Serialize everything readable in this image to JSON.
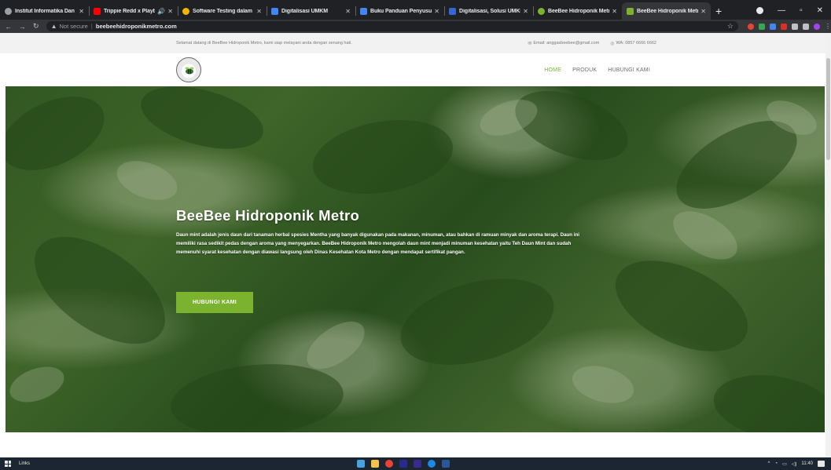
{
  "browser": {
    "tabs": [
      {
        "title": "Institut Informatika Dan Bi",
        "color": "#9aa0a6"
      },
      {
        "title": "Trippie Redd x Playbo",
        "color": "#ff0000"
      },
      {
        "title": "Software Testing dalam In",
        "color": "#f4b400"
      },
      {
        "title": "Digitalisasi UMKM",
        "color": "#4285f4"
      },
      {
        "title": "Buku Panduan Penyusuna",
        "color": "#4285f4"
      },
      {
        "title": "Digitalisasi, Solusi UMKM",
        "color": "#3367d6"
      },
      {
        "title": "BeeBee Hidroponik Metro",
        "color": "#7bb32e"
      },
      {
        "title": "BeeBee Hidroponik Metro",
        "color": "#7bb32e"
      }
    ],
    "not_secure": "Not secure",
    "url": "beebeehidroponikmetro.com"
  },
  "site": {
    "welcome": "Selamat datang di BeeBee Hidroponik Metro, kami siap melayani anda dengan senang hati.",
    "email": "Email: anggasbeebee@gmail.com",
    "wa": "WA: 0857 6666 6662",
    "nav": {
      "home": "HOME",
      "produk": "PRODUK",
      "hubungi": "HUBUNGI KAMI"
    },
    "hero": {
      "title": "BeeBee Hidroponik Metro",
      "text": "Daun mint adalah jenis daun dari tanaman herbal spesies Mentha yang banyak digunakan pada makanan, minuman, atau bahkan di ramuan minyak dan aroma terapi. Daun ini memiliki rasa sedikit pedas dengan aroma yang menyegarkan. BeeBee Hidroponik Metro mengolah daun mint menjadi minuman kesehatan yaitu Teh Daun Mint dan sudah memenuhi syarat kesehatan dengan diawasi langsung oleh Dinas Kesehatan Kota Metro dengan mendapat sertifikat pangan.",
      "button": "HUBUNGI KAMI"
    },
    "accent": "#7bb32e"
  },
  "taskbar": {
    "links": "Links",
    "clock": "11:40"
  }
}
